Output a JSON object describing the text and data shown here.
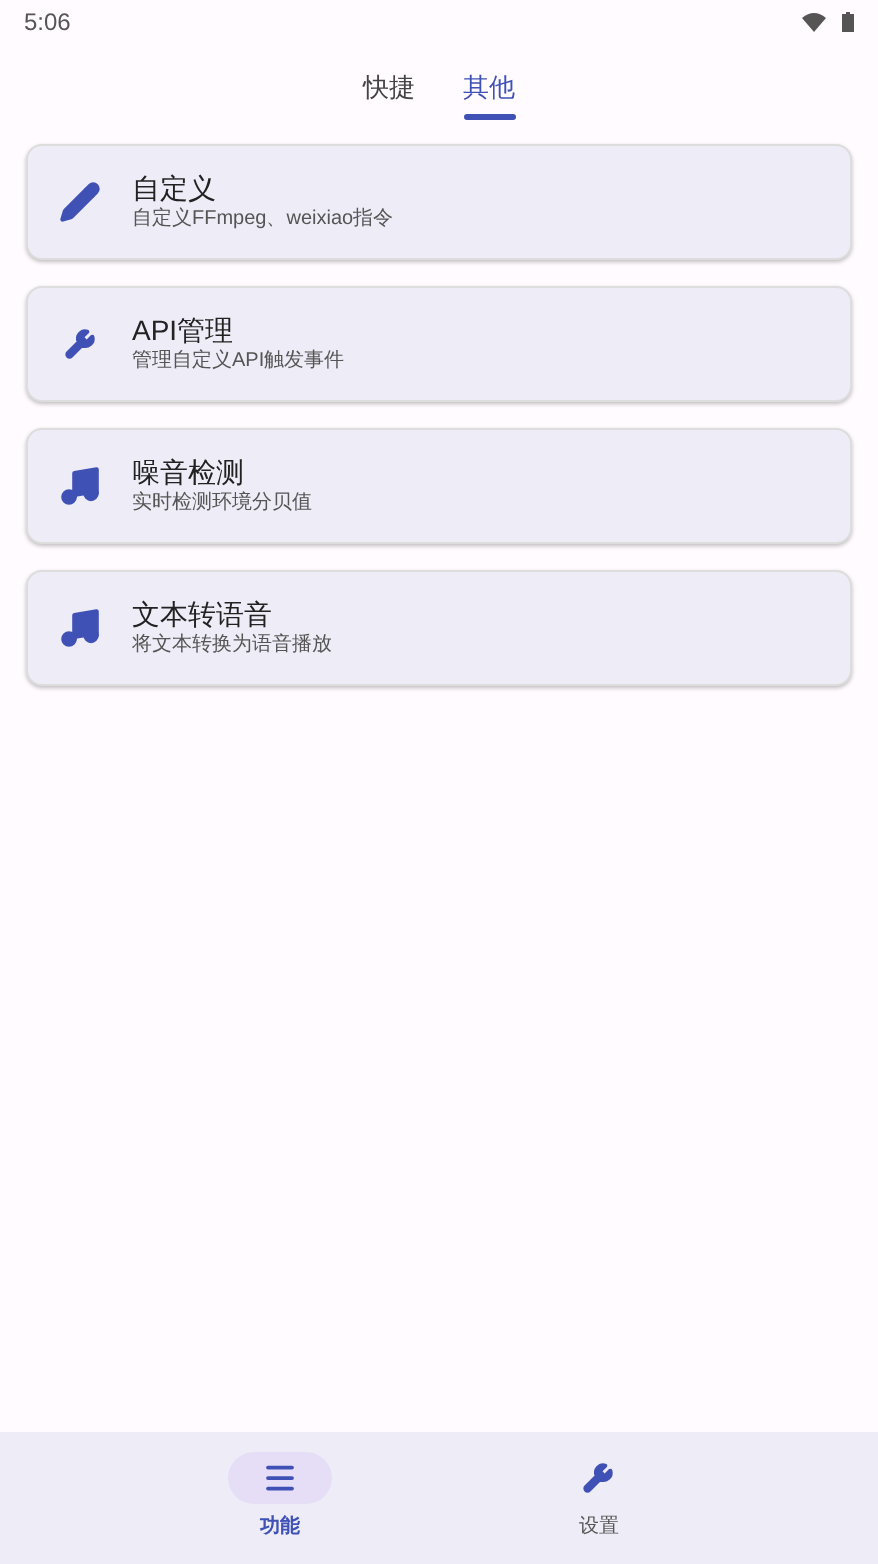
{
  "status_bar": {
    "time": "5:06"
  },
  "tabs": [
    {
      "label": "快捷",
      "selected": false
    },
    {
      "label": "其他",
      "selected": true
    }
  ],
  "cards": [
    {
      "kind": "edit",
      "title": "自定义",
      "subtitle": "自定义FFmpeg、weixiao指令"
    },
    {
      "kind": "tools",
      "title": "API管理",
      "subtitle": "管理自定义API触发事件"
    },
    {
      "kind": "music",
      "title": "噪音检测",
      "subtitle": "实时检测环境分贝值"
    },
    {
      "kind": "music",
      "title": "文本转语音",
      "subtitle": "将文本转换为语音播放"
    }
  ],
  "bottom_nav": [
    {
      "kind": "list",
      "label": "功能",
      "selected": true
    },
    {
      "kind": "tools",
      "label": "设置",
      "selected": false
    }
  ]
}
